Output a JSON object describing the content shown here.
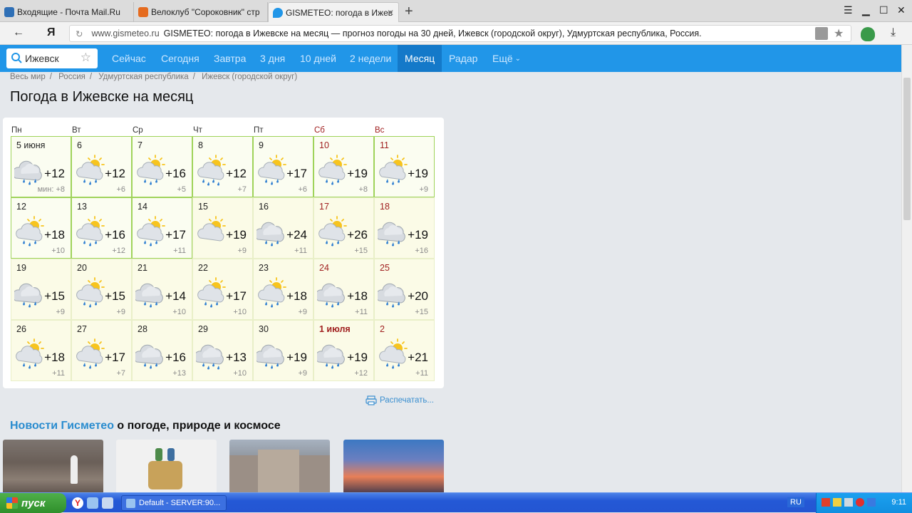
{
  "browser": {
    "tabs": [
      {
        "title": "Входящие - Почта Mail.Ru",
        "color": "#2e6fb6"
      },
      {
        "title": "Велоклуб \"Сороковник\" стр",
        "color": "#e56b1f"
      },
      {
        "title": "GISMETEO: погода в Ижев",
        "color": "#2196e8"
      }
    ],
    "new_tab": "+",
    "address_host": "www.gismeteo.ru",
    "address_title": "GISMETEO: погода в Ижевске на месяц — прогноз погоды на 30 дней, Ижевск (городской округ), Удмуртская республика, Россия.",
    "ya_label": "Я"
  },
  "site": {
    "search_value": "Ижевск",
    "nav": [
      "Сейчас",
      "Сегодня",
      "Завтра",
      "3 дня",
      "10 дней",
      "2 недели",
      "Месяц",
      "Радар",
      "Ещё"
    ],
    "active_nav": "Месяц",
    "breadcrumbs": [
      "Весь мир",
      "Россия",
      "Удмуртская республика",
      "Ижевск (городской округ)"
    ],
    "title": "Погода в Ижевске на месяц",
    "weekdays": [
      "Пн",
      "Вт",
      "Ср",
      "Чт",
      "Пт",
      "Сб",
      "Вс"
    ],
    "weeks": [
      [
        {
          "date": "5 июня",
          "icon": "cloud-rain",
          "hi": "+12",
          "lo": "мин: +8",
          "past": true
        },
        {
          "date": "6",
          "icon": "sun-cloud-rain",
          "hi": "+12",
          "lo": "+6",
          "past": true
        },
        {
          "date": "7",
          "icon": "sun-cloud-rain",
          "hi": "+16",
          "lo": "+5",
          "past": true
        },
        {
          "date": "8",
          "icon": "sun-cloud-heavy-rain",
          "hi": "+12",
          "lo": "+7",
          "past": true
        },
        {
          "date": "9",
          "icon": "sun-cloud-rain",
          "hi": "+17",
          "lo": "+6",
          "past": true
        },
        {
          "date": "10",
          "icon": "sun-cloud-rain",
          "hi": "+19",
          "lo": "+8",
          "past": true,
          "weekend": true
        },
        {
          "date": "11",
          "icon": "sun-cloud-rain",
          "hi": "+19",
          "lo": "+9",
          "past": true,
          "weekend": true
        }
      ],
      [
        {
          "date": "12",
          "icon": "sun-cloud-rain",
          "hi": "+18",
          "lo": "+10",
          "past": true
        },
        {
          "date": "13",
          "icon": "sun-cloud-rain",
          "hi": "+16",
          "lo": "+12",
          "past": true
        },
        {
          "date": "14",
          "icon": "sun-cloud-rain",
          "hi": "+17",
          "lo": "+11",
          "past": true
        },
        {
          "date": "15",
          "icon": "sun-cloud",
          "hi": "+19",
          "lo": "+9"
        },
        {
          "date": "16",
          "icon": "cloud-rain",
          "hi": "+24",
          "lo": "+11"
        },
        {
          "date": "17",
          "icon": "sun-cloud-rain",
          "hi": "+26",
          "lo": "+15",
          "weekend": true
        },
        {
          "date": "18",
          "icon": "cloud-rain",
          "hi": "+19",
          "lo": "+16",
          "weekend": true
        }
      ],
      [
        {
          "date": "19",
          "icon": "cloud-rain",
          "hi": "+15",
          "lo": "+9"
        },
        {
          "date": "20",
          "icon": "sun-cloud-rain",
          "hi": "+15",
          "lo": "+9"
        },
        {
          "date": "21",
          "icon": "cloud-rain",
          "hi": "+14",
          "lo": "+10"
        },
        {
          "date": "22",
          "icon": "sun-cloud-rain",
          "hi": "+17",
          "lo": "+10"
        },
        {
          "date": "23",
          "icon": "sun-cloud-rain",
          "hi": "+18",
          "lo": "+9"
        },
        {
          "date": "24",
          "icon": "cloud-rain",
          "hi": "+18",
          "lo": "+11",
          "weekend": true
        },
        {
          "date": "25",
          "icon": "cloud-rain",
          "hi": "+20",
          "lo": "+15",
          "weekend": true
        }
      ],
      [
        {
          "date": "26",
          "icon": "sun-cloud-rain",
          "hi": "+18",
          "lo": "+11"
        },
        {
          "date": "27",
          "icon": "sun-cloud-rain",
          "hi": "+17",
          "lo": "+7"
        },
        {
          "date": "28",
          "icon": "cloud-rain",
          "hi": "+16",
          "lo": "+13"
        },
        {
          "date": "29",
          "icon": "cloud-heavy-rain",
          "hi": "+13",
          "lo": "+10"
        },
        {
          "date": "30",
          "icon": "cloud-rain",
          "hi": "+19",
          "lo": "+9"
        },
        {
          "date": "1 июля",
          "icon": "cloud-rain",
          "hi": "+19",
          "lo": "+12",
          "weekend": true,
          "month_start": true
        },
        {
          "date": "2",
          "icon": "sun-cloud-rain",
          "hi": "+21",
          "lo": "+11",
          "weekend": true
        }
      ]
    ],
    "print_label": "Распечатать...",
    "news_link": "Новости Гисметео",
    "news_rest": " о погоде, природе и космосе"
  },
  "taskbar": {
    "start_label": "пуск",
    "task_label": "Default - SERVER:90...",
    "lang": "RU",
    "clock": "9:11"
  }
}
